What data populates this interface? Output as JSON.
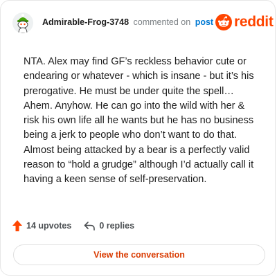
{
  "header": {
    "username": "Admirable-Frog-3748",
    "commented_text": "commented on",
    "post_link": "post",
    "brand": "reddit"
  },
  "comment": {
    "text": "NTA. Alex may find GF’s reckless behavior cute or endearing or whatever - which is insane - but it’s his prerogative. He must be under quite the spell… Ahem. Anyhow. He can go into the wild with her & risk his own life all he wants but he has no business being a jerk to people who don’t want to do that. Almost being attacked by a bear is a perfectly valid reason to “hold a grudge” although I’d actually call it having a keen sense of self-preservation."
  },
  "stats": {
    "upvotes": "14 upvotes",
    "replies": "0 replies"
  },
  "footer": {
    "view_label": "View the conversation"
  },
  "colors": {
    "brand": "#ff4500",
    "link": "#0079d3",
    "button_text": "#d93a00",
    "avatar_green": "#46a508"
  },
  "icons": {
    "avatar": "snoo-avatar-icon",
    "brand": "reddit-logo-icon",
    "upvote": "upvote-arrow-icon",
    "reply": "reply-arrow-icon"
  }
}
